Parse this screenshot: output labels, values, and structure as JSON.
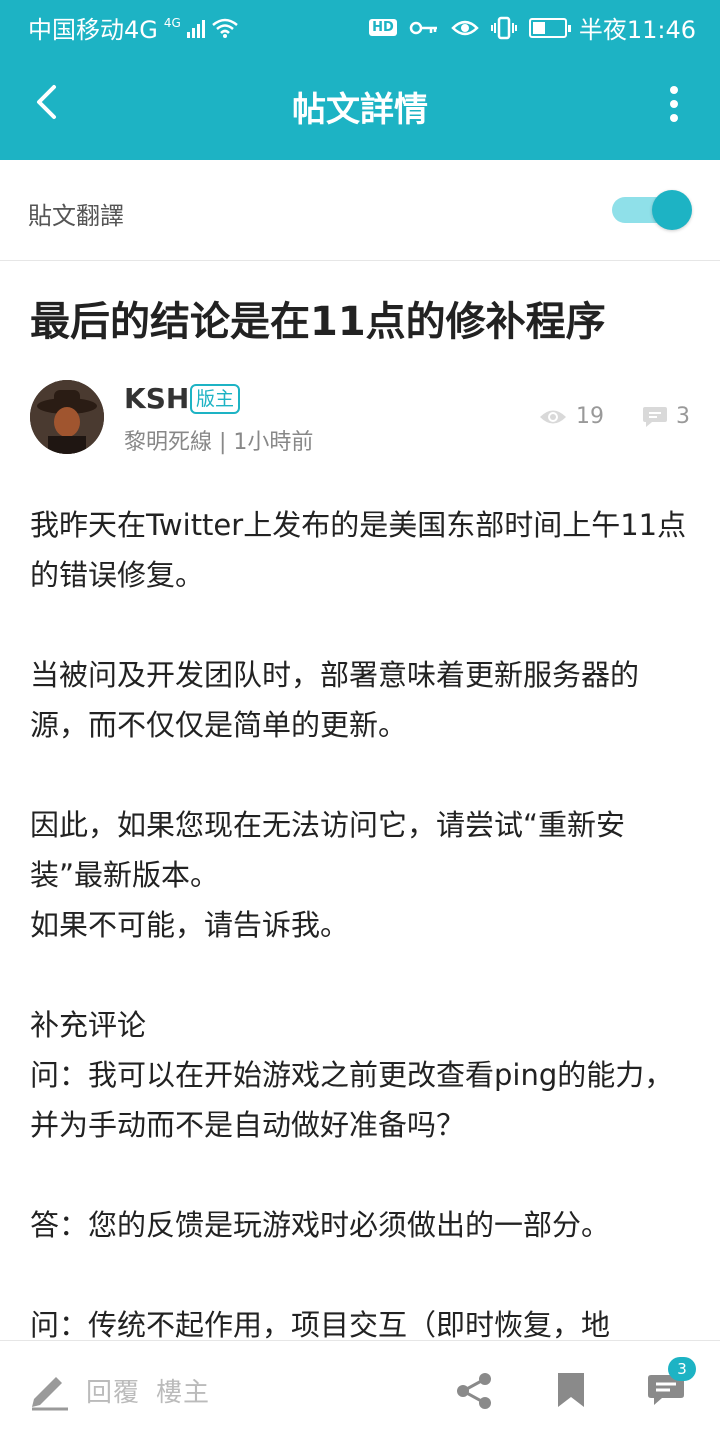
{
  "status_bar": {
    "carrier": "中国移动4G",
    "network_tag": "4G",
    "time": "半夜11:46",
    "battery_level": 0.4,
    "icons": [
      "signal-icon",
      "wifi-icon",
      "hd-icon",
      "key-icon",
      "eye-icon",
      "vibrate-icon",
      "battery-icon"
    ]
  },
  "app_bar": {
    "title": "帖文詳情",
    "hd_label": "HD"
  },
  "translate": {
    "label": "貼文翻譯",
    "enabled": true
  },
  "post": {
    "title": "最后的结论是在11点的修补程序",
    "author": {
      "name": "KSH",
      "badge": "版主",
      "subtitle": "黎明死線 | 1小時前"
    },
    "views": "19",
    "comments": "3",
    "paragraphs": [
      "我昨天在Twitter上发布的是美国东部时间上午11点的错误修复。",
      "",
      "当被问及开发团队时，部署意味着更新服务器的源，而不仅仅是简单的更新。",
      "",
      "因此，如果您现在无法访问它，请尝试“重新安装”最新版本。",
      "如果不可能，请告诉我。",
      "",
      "补充评论",
      "问：我可以在开始游戏之前更改查看ping的能力，并为手动而不是自动做好准备吗？",
      "",
      "答：您的反馈是玩游戏时必须做出的一部分。",
      "",
      "问：传统不起作用，项目交互（即时恢复，地"
    ]
  },
  "bottom_bar": {
    "reply_label": "回覆",
    "reply_target": "樓主",
    "comment_badge": "3"
  },
  "colors": {
    "accent": "#1db3c4",
    "toggle_track": "#8fe0e9"
  }
}
